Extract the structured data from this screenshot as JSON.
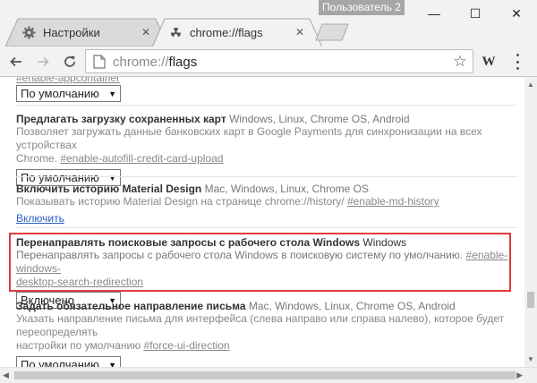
{
  "window": {
    "user_badge": "Пользователь 2",
    "minimize": "—",
    "maximize": "☐",
    "close": "✕"
  },
  "tabs": [
    {
      "title": "Настройки",
      "icon": "gear-icon",
      "active": false
    },
    {
      "title": "chrome://flags",
      "icon": "radiation-icon",
      "active": true
    }
  ],
  "toolbar": {
    "url_scheme": "chrome://",
    "url_path": "flags",
    "extension_label": "W"
  },
  "flags": [
    {
      "title": "",
      "platforms": "",
      "description": "",
      "hash": "#enable-appcontainer",
      "select_value": "По умолчанию"
    },
    {
      "title": "Предлагать загрузку сохраненных карт",
      "platforms": "Windows, Linux, Chrome OS, Android",
      "description_line1": "Позволяет загружать данные банковских карт в Google Payments для синхронизации на всех устройствах",
      "description_line2": "Chrome.",
      "hash": "#enable-autofill-credit-card-upload",
      "select_value": "По умолчанию"
    },
    {
      "title": "Включить историю Material Design",
      "platforms": "Mac, Windows, Linux, Chrome OS",
      "description": "Показывать историю Material Design на странице chrome://history/",
      "hash": "#enable-md-history",
      "action": "Включить"
    },
    {
      "title": "Перенаправлять поисковые запросы с рабочего стола Windows",
      "platforms": "Windows",
      "description": "Перенаправлять запросы с рабочего стола Windows в поисковую систему по умолчанию.",
      "hash_part1": "#enable-windows-",
      "hash_part2": "desktop-search-redirection",
      "select_value": "Включено"
    },
    {
      "title": "Задать обязательное направление письма",
      "platforms": "Mac, Windows, Linux, Chrome OS, Android",
      "description_line1": "Указать направление письма для интерфейса (слева направо или справа налево), которое будет переопределять",
      "description_line2": "настройки по умолчанию",
      "hash": "#force-ui-direction",
      "select_value": "По умолчанию"
    }
  ],
  "colors": {
    "highlight_border": "#e03c3c",
    "link": "#2b5fc7",
    "user_badge_bg": "#a6a6a6"
  }
}
